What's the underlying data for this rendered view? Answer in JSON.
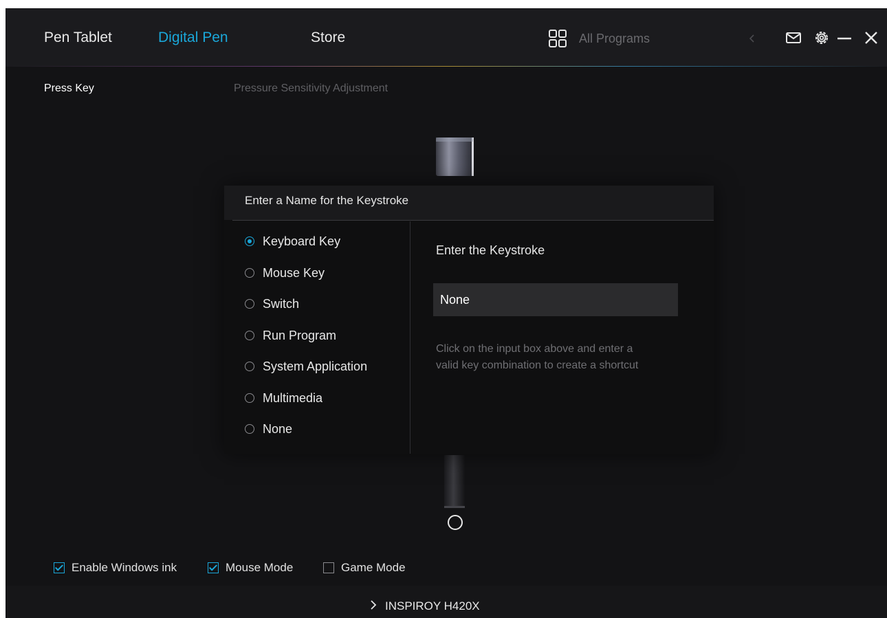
{
  "nav": {
    "tabs": [
      {
        "label": "Pen Tablet"
      },
      {
        "label": "Digital Pen"
      },
      {
        "label": "Store"
      }
    ],
    "active_tab": "Digital Pen",
    "programs_label": "All Programs"
  },
  "subtabs": {
    "press_key": "Press Key",
    "pressure": "Pressure Sensitivity Adjustment"
  },
  "dialog": {
    "title": "Enter a Name for the Keystroke",
    "options": [
      {
        "label": "Keyboard Key",
        "checked": true
      },
      {
        "label": "Mouse Key",
        "checked": false
      },
      {
        "label": "Switch",
        "checked": false
      },
      {
        "label": "Run Program",
        "checked": false
      },
      {
        "label": "System Application",
        "checked": false
      },
      {
        "label": "Multimedia",
        "checked": false
      },
      {
        "label": "None",
        "checked": false
      }
    ],
    "keystroke_title": "Enter the Keystroke",
    "keystroke_value": "None",
    "hint": "Click on the input box above and enter a valid key combination to create a shortcut"
  },
  "checks": [
    {
      "label": "Enable Windows ink",
      "checked": true
    },
    {
      "label": "Mouse Mode",
      "checked": true
    },
    {
      "label": "Game Mode",
      "checked": false
    }
  ],
  "device": {
    "label": "INSPIROY H420X"
  },
  "icons": {
    "grid": "grid-icon",
    "mail": "mail-icon",
    "settings": "gear-icon",
    "minimize": "minimize-icon",
    "close": "close-icon"
  },
  "colors": {
    "accent": "#1aa7d9",
    "background": "#131315"
  }
}
